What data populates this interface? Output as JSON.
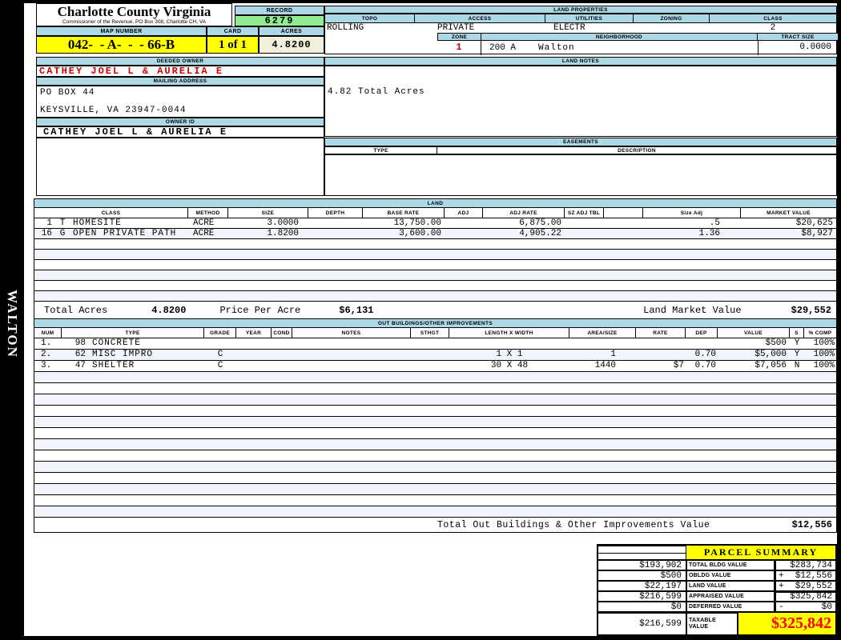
{
  "colors": {
    "header_bar_blue": "#ADD8E6",
    "record_green": "#90EE90",
    "highlight_yellow": "#FFFF00",
    "acres_cream": "#F2EFDA",
    "owner_red": "#CC0000",
    "total_red": "#FF0000",
    "row_stripe": "#F1F4FB"
  },
  "header": {
    "county_title": "Charlotte County Virginia",
    "county_subtitle": "Commissioner of the Revenue, PO Box 308, Charlotte CH, VA",
    "record_label": "RECORD",
    "record_value": "6279",
    "map_number_label": "MAP NUMBER",
    "map_number_value": "042-  - A-  -  - 66-B",
    "card_label": "CARD",
    "card_value": "1 of 1",
    "acres_label": "ACRES",
    "acres_value": "4.8200"
  },
  "sidebar": {
    "district_vertical_label": "WALTON"
  },
  "owner": {
    "deeded_owner_label": "DEEDED OWNER",
    "deeded_owner": "CATHEY JOEL L & AURELIA E",
    "mailing_address_label": "MAILING ADDRESS",
    "address_line1": "PO BOX 44",
    "address_line2": "KEYSVILLE, VA 23947-0044",
    "owner_id_label": "OWNER ID",
    "owner_id": "CATHEY JOEL L & AURELIA E"
  },
  "land_properties": {
    "title": "LAND PROPERTIES",
    "topo_label": "TOPO",
    "topo_value": "ROLLING",
    "access_label": "ACCESS",
    "access_value": "PRIVATE",
    "utilities_label": "UTILITIES",
    "utilities_value": "ELECTR",
    "zoning_label": "ZONING",
    "zoning_value": "",
    "class_label": "CLASS",
    "class_value": "2",
    "zone_label": "ZONE",
    "zone_value": "1",
    "neighborhood_label": "NEIGHBORHOOD",
    "neighborhood_code": "200 A",
    "neighborhood_name": "Walton",
    "tract_size_label": "TRACT SIZE",
    "tract_size_value": "0.0000"
  },
  "land_notes": {
    "title": "LAND NOTES",
    "note": "4.82 Total Acres"
  },
  "easements": {
    "title": "EASEMENTS",
    "type_label": "TYPE",
    "description_label": "DESCRIPTION"
  },
  "land": {
    "title": "LAND",
    "headers": {
      "class": "CLASS",
      "method": "METHOD",
      "size": "SIZE",
      "depth": "DEPTH",
      "base_rate": "BASE RATE",
      "adj": "ADJ",
      "adj_rate": "ADJ RATE",
      "sz_adj_tbl": "SZ ADJ TBL",
      "size_adj": "Size Adj",
      "market_value": "MARKET VALUE"
    },
    "rows": [
      {
        "num": "1",
        "code": "T",
        "name": "HOMESITE",
        "method": "ACRE",
        "size": "3.0000",
        "depth": "",
        "base_rate": "13,750.00",
        "adj": "",
        "adj_rate": "6,875.00",
        "sz_adj_tbl": "",
        "size_adj": ".5",
        "market_value": "$20,625"
      },
      {
        "num": "16",
        "code": "G",
        "name": "OPEN PRIVATE PATH",
        "method": "ACRE",
        "size": "1.8200",
        "depth": "",
        "base_rate": "3,600.00",
        "adj": "",
        "adj_rate": "4,905.22",
        "sz_adj_tbl": "",
        "size_adj": "1.36",
        "market_value": "$8,927"
      }
    ],
    "totals": {
      "total_acres_label": "Total Acres",
      "total_acres_value": "4.8200",
      "price_per_acre_label": "Price Per Acre",
      "price_per_acre_value": "$6,131",
      "land_market_value_label": "Land Market Value",
      "land_market_value_value": "$29,552"
    }
  },
  "out_buildings": {
    "title": "OUT BUILDINGS/OTHER IMPROVEMENTS",
    "headers": {
      "num": "NUM",
      "type": "TYPE",
      "grade": "GRADE",
      "year": "YEAR",
      "cond": "COND",
      "notes": "NOTES",
      "sthgt": "STHGT",
      "length_width": "LENGTH X WIDTH",
      "area_size": "AREA/SIZE",
      "rate": "RATE",
      "dep": "DEP",
      "value": "VALUE",
      "s": "S",
      "pct_comp": "% COMP"
    },
    "rows": [
      {
        "num": "1.",
        "code": "98",
        "name": "CONCRETE",
        "grade": "",
        "year": "",
        "cond": "",
        "notes": "",
        "sthgt": "",
        "length_width": "",
        "area_size": "",
        "rate": "",
        "dep": "",
        "value": "$500",
        "s": "Y",
        "pct_comp": "100%"
      },
      {
        "num": "2.",
        "code": "62",
        "name": "MISC IMPRO",
        "grade": "C",
        "year": "",
        "cond": "",
        "notes": "",
        "sthgt": "",
        "length_width": "1 X 1",
        "area_size": "1",
        "rate": "",
        "dep": "0.70",
        "value": "$5,000",
        "s": "Y",
        "pct_comp": "100%"
      },
      {
        "num": "3.",
        "code": "47",
        "name": "SHELTER",
        "grade": "C",
        "year": "",
        "cond": "",
        "notes": "",
        "sthgt": "",
        "length_width": "30 X 48",
        "area_size": "1440",
        "rate": "$7",
        "dep": "0.70",
        "value": "$7,056",
        "s": "N",
        "pct_comp": "100%"
      }
    ],
    "total_label": "Total Out Buildings & Other Improvements Value",
    "total_value": "$12,556"
  },
  "parcel_summary": {
    "title": "PARCEL SUMMARY",
    "rows": [
      {
        "left": "$193,902",
        "label": "TOTAL BLDG VALUE",
        "sign": "",
        "right": "$283,734"
      },
      {
        "left": "$500",
        "label": "OBLDG VALUE",
        "sign": "+",
        "right": "$12,556"
      },
      {
        "left": "$22,197",
        "label": "LAND VALUE",
        "sign": "+",
        "right": "$29,552"
      },
      {
        "left": "$216,599",
        "label": "APPRAISED VALUE",
        "sign": "",
        "right": "$325,842"
      },
      {
        "left": "$0",
        "label": "DEFERRED VALUE",
        "sign": "-",
        "right": "$0"
      }
    ],
    "taxable": {
      "left": "$216,599",
      "label": "TAXABLE VALUE",
      "value": "$325,842"
    }
  }
}
